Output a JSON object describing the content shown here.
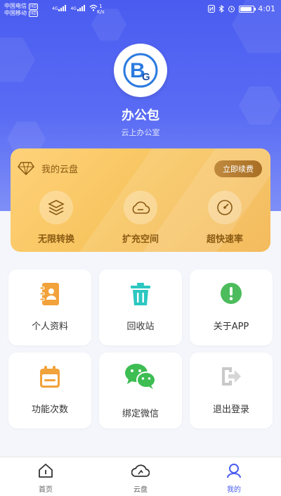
{
  "status_bar": {
    "carrier_1": "中国电信",
    "carrier_1_tag": "HD",
    "carrier_2": "中国移动",
    "carrier_2_tag": "HD",
    "network_1": "4G",
    "network_2": "4G",
    "speed_value": "1",
    "speed_unit": "K/s",
    "time": "4:01",
    "battery_level": 0.9
  },
  "profile": {
    "app_name": "办公包",
    "app_subtitle": "云上办公室",
    "logo_letters": "BG",
    "logo_color": "#2b7be0"
  },
  "cloud_card": {
    "title": "我的云盘",
    "renew_label": "立即续费",
    "features": [
      {
        "label": "无限转换",
        "icon": "layers-icon"
      },
      {
        "label": "扩充空间",
        "icon": "cloud-icon"
      },
      {
        "label": "超快速率",
        "icon": "speedometer-icon"
      }
    ],
    "text_color": "#8a5a12"
  },
  "grid": {
    "items": [
      {
        "label": "个人资料",
        "icon": "contact-book-icon",
        "color": "#f2a23a"
      },
      {
        "label": "回收站",
        "icon": "trash-icon",
        "color": "#2cc7c0"
      },
      {
        "label": "关于APP",
        "icon": "info-exclamation-icon",
        "color": "#4cbc5c"
      },
      {
        "label": "功能次数",
        "icon": "calendar-icon",
        "color": "#f2a23a"
      },
      {
        "label": "绑定微信",
        "icon": "wechat-icon",
        "color": "#3dbd52"
      },
      {
        "label": "退出登录",
        "icon": "logout-icon",
        "color": "#c9c9c9"
      }
    ]
  },
  "tabbar": {
    "tabs": [
      {
        "label": "首页",
        "icon": "home-icon",
        "active": false
      },
      {
        "label": "云盘",
        "icon": "cloud-upload-icon",
        "active": false
      },
      {
        "label": "我的",
        "icon": "user-icon",
        "active": true
      }
    ],
    "active_color": "#4a5cf0"
  },
  "colors": {
    "hero": "#4a5cf0",
    "background": "#f4f6fb"
  }
}
